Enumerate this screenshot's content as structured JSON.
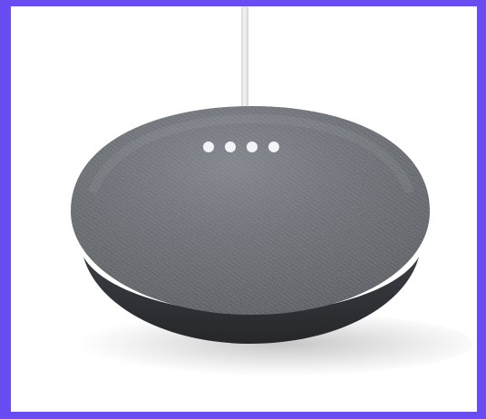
{
  "image": {
    "subject": "speaker-device",
    "colors": {
      "frame_border": "#6a4cf3",
      "background": "#ffffff",
      "fabric": "#4b4f55",
      "base": "#2f3135",
      "led": "#f2f4f7",
      "cable": "#e8e8e8"
    },
    "led_count": 4
  }
}
